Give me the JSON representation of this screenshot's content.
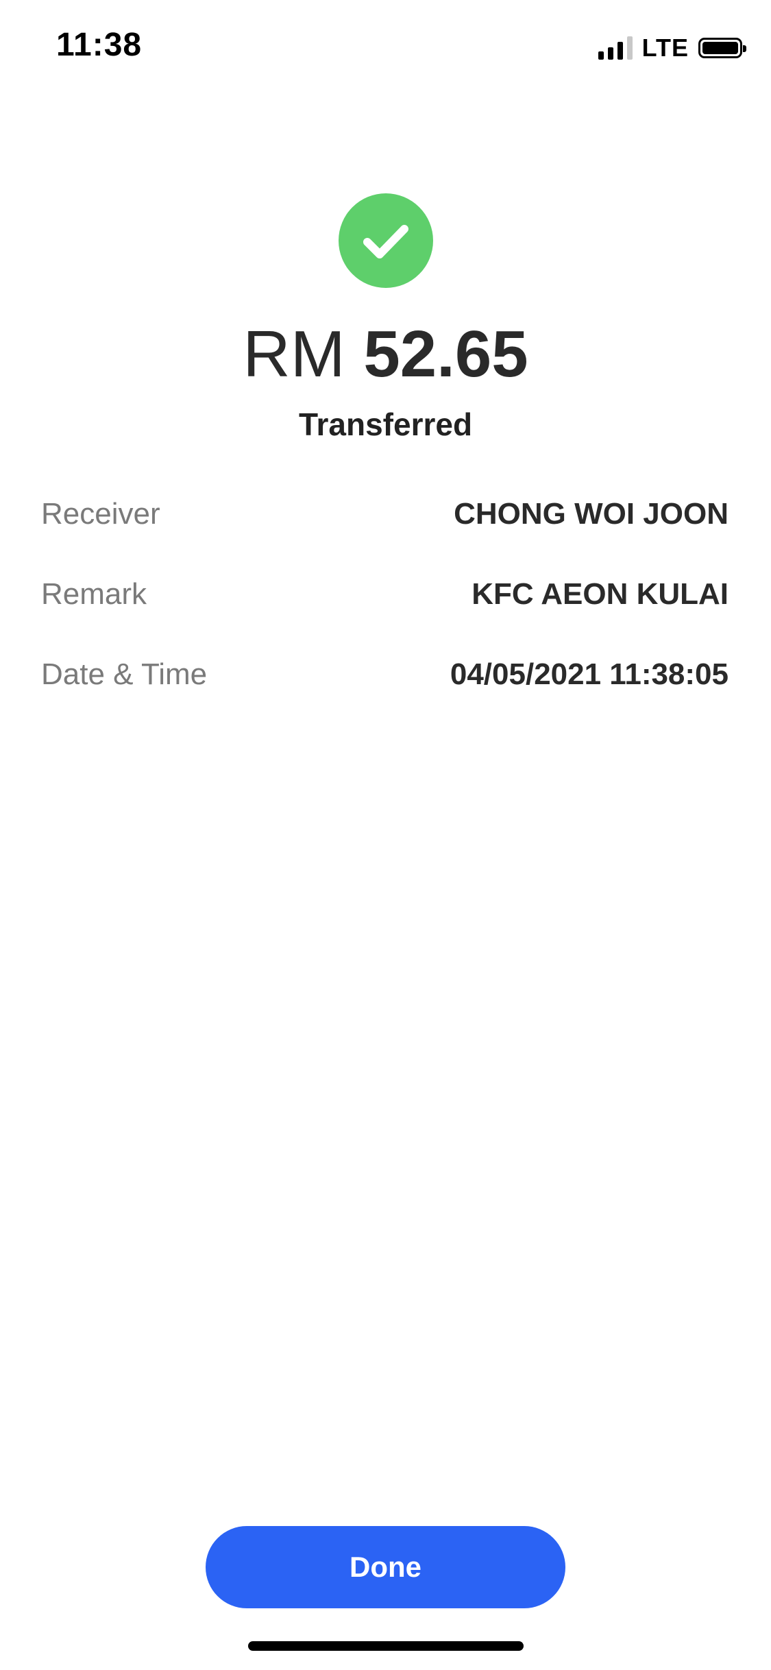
{
  "status_bar": {
    "time": "11:38",
    "carrier": "LTE",
    "icons": [
      "signal-icon",
      "battery-icon"
    ]
  },
  "receipt": {
    "status_icon": "checkmark-icon",
    "status_color": "#5ecf6b",
    "currency": "RM",
    "amount": "52.65",
    "status_label": "Transferred",
    "details": [
      {
        "label": "Receiver",
        "value": "CHONG WOI JOON"
      },
      {
        "label": "Remark",
        "value": "KFC AEON KULAI"
      },
      {
        "label": "Date & Time",
        "value": "04/05/2021 11:38:05"
      }
    ]
  },
  "actions": {
    "done_label": "Done",
    "accent_color": "#2b63f4"
  }
}
